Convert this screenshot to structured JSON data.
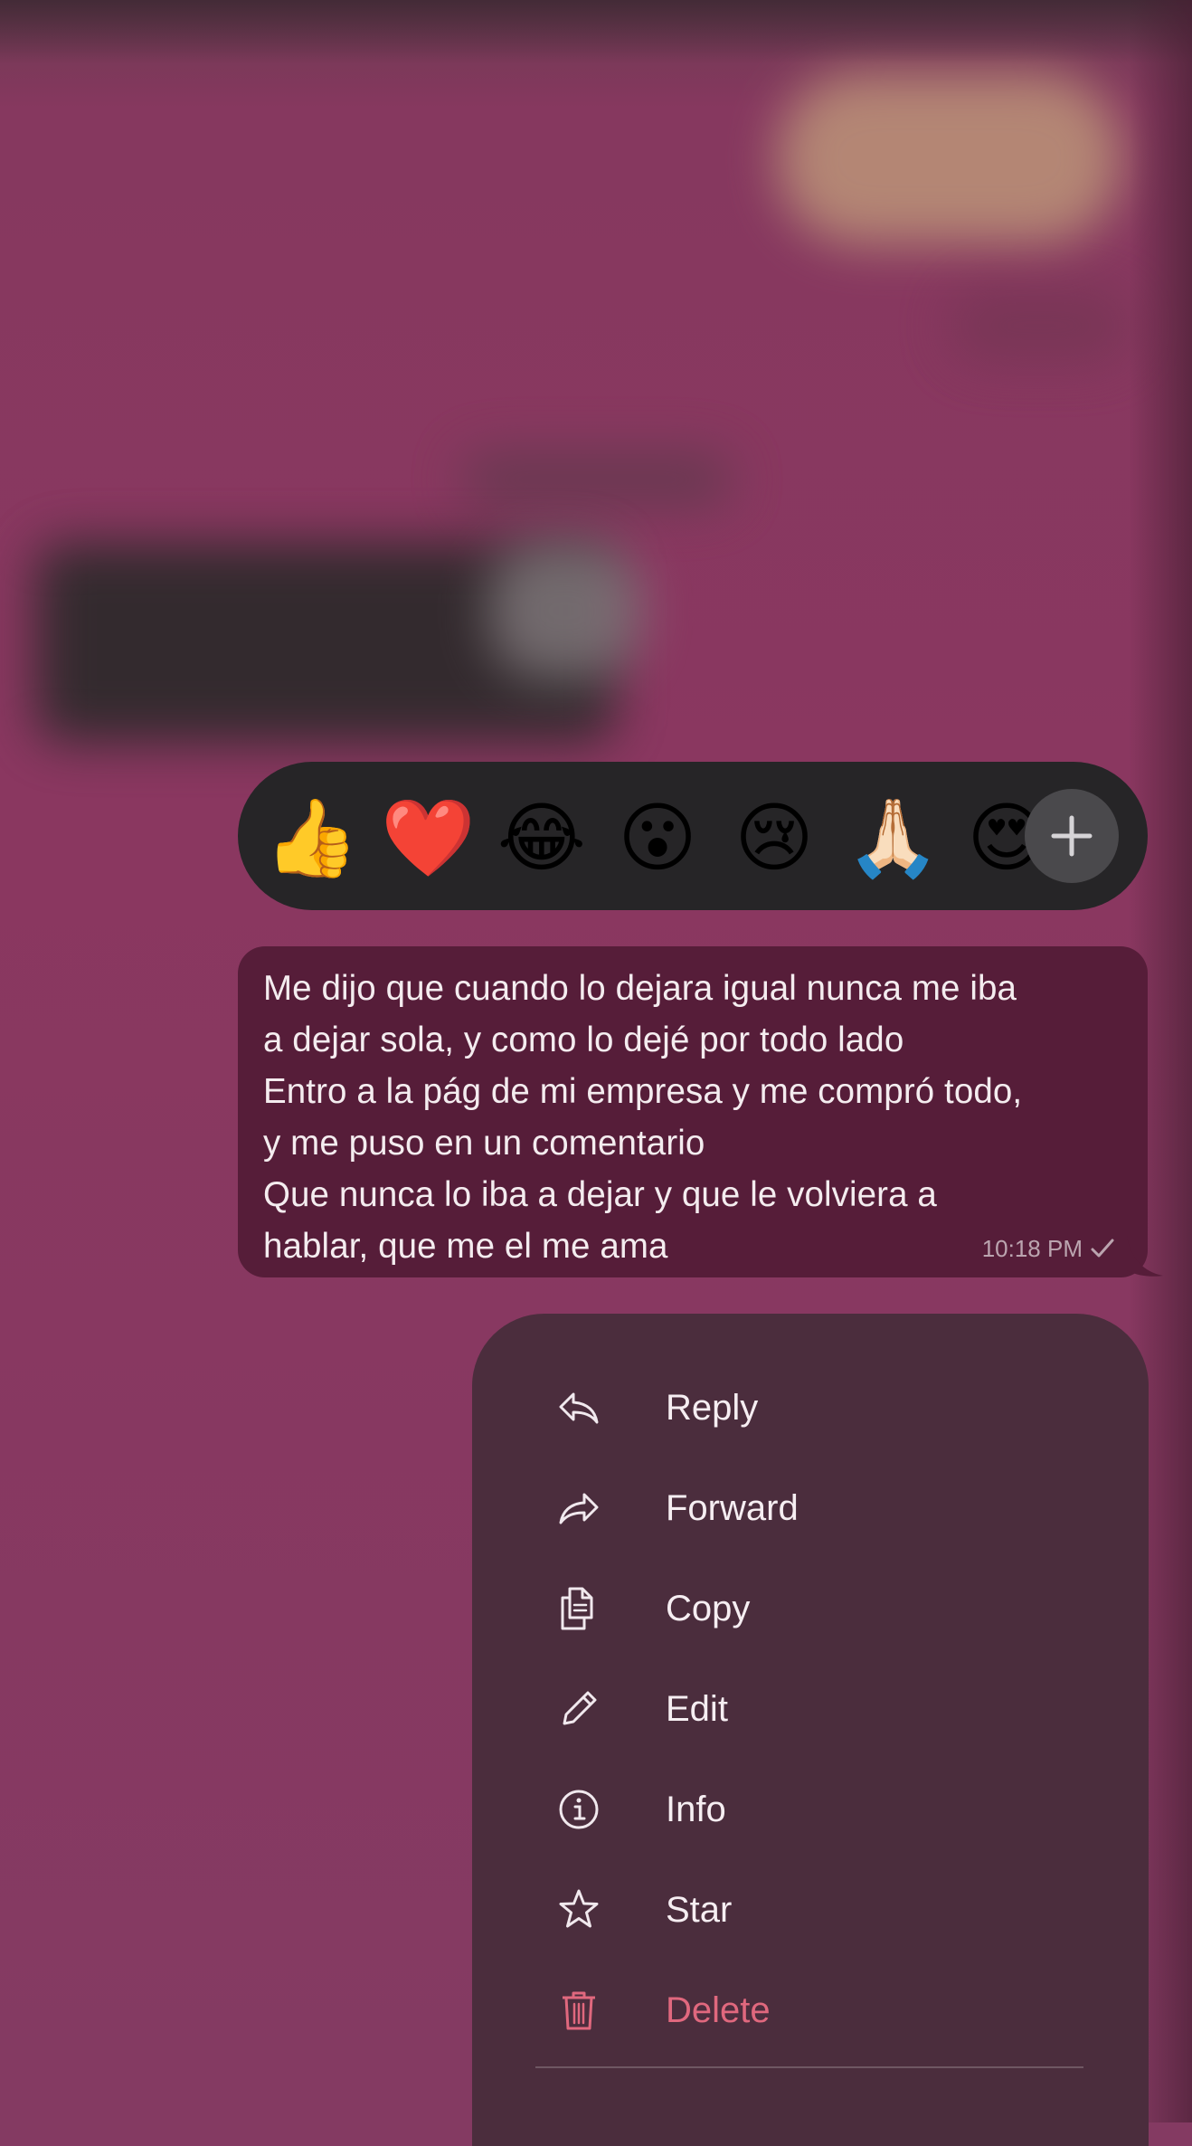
{
  "reactions": {
    "emojis": [
      "👍",
      "❤️",
      "😂",
      "😮",
      "😢",
      "🙏🏻",
      "😍"
    ],
    "more_icon": "plus-icon"
  },
  "message": {
    "lines": [
      "Me dijo que cuando lo dejara igual nunca me iba",
      "a dejar sola, y como lo dejé por todo lado",
      "Entro a la pág de mi empresa y me compró todo,",
      "y me puso en un comentario",
      "Que nunca lo iba a dejar y que le volviera a",
      "hablar, que me el me ama"
    ],
    "time": "10:18 PM",
    "status_icon": "single-check-icon"
  },
  "menu": {
    "items": [
      {
        "label": "Reply",
        "icon": "reply-icon"
      },
      {
        "label": "Forward",
        "icon": "forward-icon"
      },
      {
        "label": "Copy",
        "icon": "copy-icon"
      },
      {
        "label": "Edit",
        "icon": "pencil-icon"
      },
      {
        "label": "Info",
        "icon": "info-icon"
      },
      {
        "label": "Star",
        "icon": "star-icon"
      },
      {
        "label": "Delete",
        "icon": "trash-icon",
        "destructive": true
      }
    ]
  },
  "colors": {
    "background": "#843a62",
    "reaction_bar": "#262527",
    "bubble": "#561d39",
    "menu": "#4b2d3d",
    "destructive": "#e0687e"
  }
}
